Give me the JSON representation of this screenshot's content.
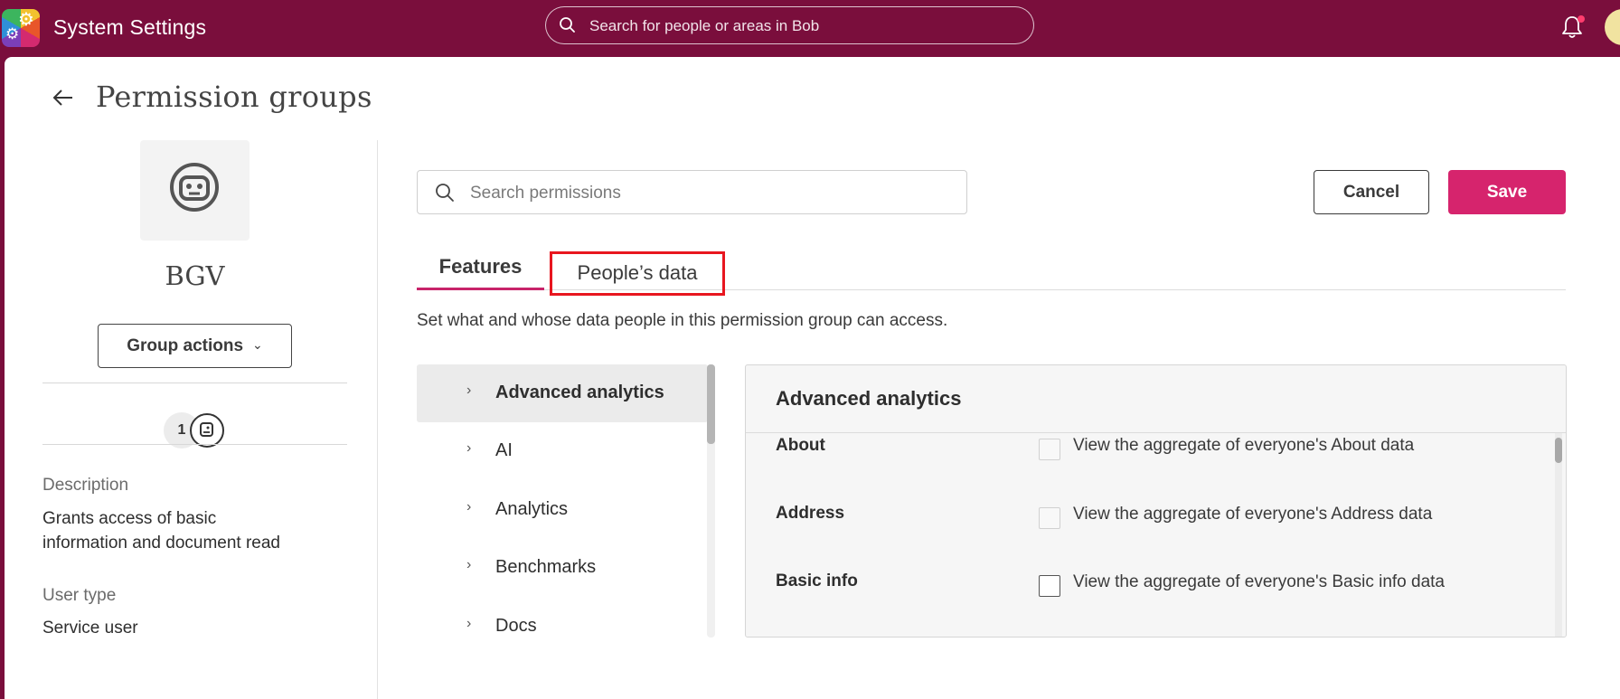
{
  "app": {
    "title": "System Settings"
  },
  "global_search": {
    "placeholder": "Search for people or areas in Bob"
  },
  "page": {
    "title": "Permission groups"
  },
  "group": {
    "name": "BGV",
    "actions_label": "Group actions",
    "member_count": "1",
    "description_label": "Description",
    "description_line1": "Grants access of basic",
    "description_line2": "information and document read",
    "user_type_label": "User type",
    "user_type_value": "Service user"
  },
  "toolbar": {
    "search_placeholder": "Search permissions",
    "cancel_label": "Cancel",
    "save_label": "Save"
  },
  "tabs": [
    {
      "label": "Features",
      "active": true
    },
    {
      "label": "People’s data",
      "active": false,
      "highlighted": true
    }
  ],
  "tab_description": "Set what and whose data people in this permission group can access.",
  "categories": [
    {
      "label": "Advanced analytics",
      "selected": true
    },
    {
      "label": "AI",
      "selected": false
    },
    {
      "label": "Analytics",
      "selected": false
    },
    {
      "label": "Benchmarks",
      "selected": false
    },
    {
      "label": "Docs",
      "selected": false
    }
  ],
  "detail": {
    "title": "Advanced analytics",
    "rows": [
      {
        "label": "About",
        "text": "View the aggregate of everyone's About data",
        "checked": false
      },
      {
        "label": "Address",
        "text": "View the aggregate of everyone's Address data",
        "checked": false
      },
      {
        "label": "Basic info",
        "text": "View the aggregate of everyone's Basic info data",
        "checked": false
      }
    ]
  },
  "colors": {
    "brand": "#7a0e3c",
    "save": "#d6246d",
    "tab_underline": "#c8236a",
    "highlight_box": "#e8161f"
  },
  "icons": {
    "logo": "settings-cogs-logo",
    "search": "search-icon",
    "bell": "bell-icon",
    "back": "arrow-left-icon",
    "group": "robot-icon",
    "member": "service-user-icon",
    "chevron": "chevron-right-icon"
  }
}
